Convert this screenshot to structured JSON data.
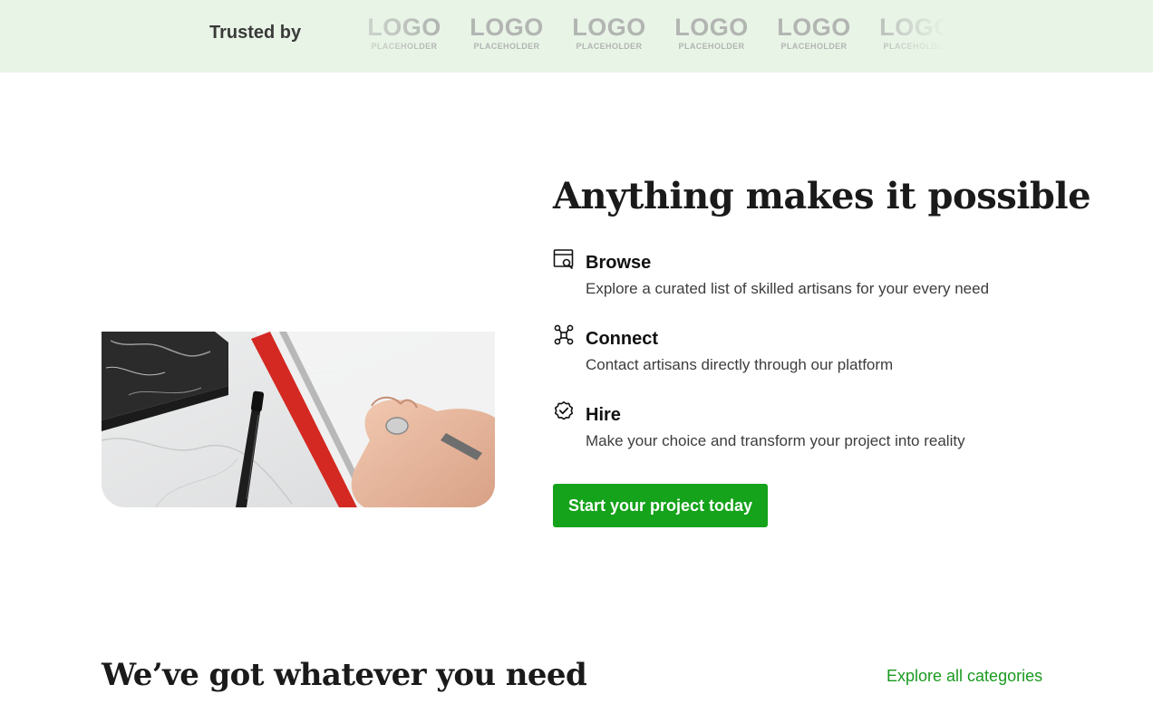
{
  "trust": {
    "label": "Trusted by",
    "logos": [
      {
        "main": "LOGO",
        "sub": "PLACEHOLDER"
      },
      {
        "main": "LOGO",
        "sub": "PLACEHOLDER"
      },
      {
        "main": "LOGO",
        "sub": "PLACEHOLDER"
      },
      {
        "main": "LOGO",
        "sub": "PLACEHOLDER"
      },
      {
        "main": "LOGO",
        "sub": "PLACEHOLDER"
      },
      {
        "main": "LOGO",
        "sub": "PLACEHOLDER"
      }
    ]
  },
  "hero": {
    "headline": "Anything makes it possible",
    "image_icon": "photo-marble-desk-ruler-pen-hand",
    "features": [
      {
        "icon": "browse-window-search-icon",
        "title": "Browse",
        "description": "Explore a curated list of skilled artisans for your every need"
      },
      {
        "icon": "connect-nodes-icon",
        "title": "Connect",
        "description": "Contact artisans directly through our platform"
      },
      {
        "icon": "hire-verified-badge-icon",
        "title": "Hire",
        "description": "Make your choice and transform your project into reality"
      }
    ],
    "cta_label": "Start your project today"
  },
  "categories": {
    "title": "We’ve got whatever you need",
    "explore_label": "Explore all categories"
  },
  "colors": {
    "trust_bar_bg": "#e8f4e6",
    "accent_green": "#14a31a",
    "link_green": "#1a9a1f",
    "text_dark": "#1a1a1a"
  }
}
